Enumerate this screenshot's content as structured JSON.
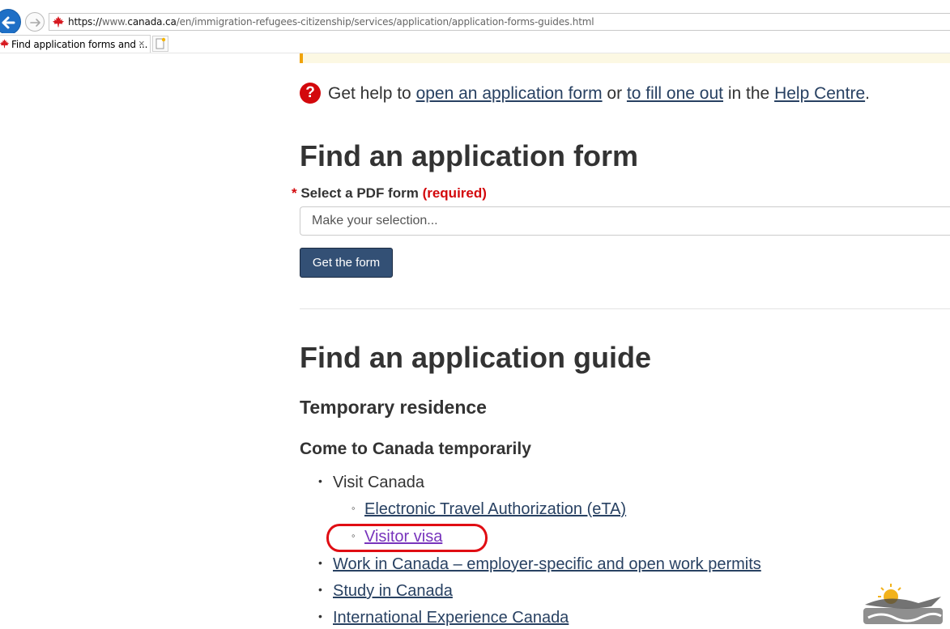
{
  "browser": {
    "url": {
      "protocol": "https://",
      "www": "www.",
      "host": "canada.ca",
      "path": "/en/immigration-refugees-citizenship/services/application/application-forms-guides.html"
    },
    "tab_title": "Find application forms and ...",
    "tab_close": "×"
  },
  "help": {
    "icon": "?",
    "prefix": "Get help to ",
    "link1": "open an application form",
    "mid1": " or ",
    "link2": "to fill one out",
    "mid2": " in the ",
    "link3": "Help Centre",
    "suffix": "."
  },
  "form_section": {
    "heading": "Find an application form",
    "label_star": "*",
    "label": " Select a PDF form ",
    "label_required": "(required)",
    "select_value": "Make your selection...",
    "button": "Get the form"
  },
  "guide_section": {
    "heading": "Find an application guide",
    "subheading": "Temporary residence",
    "group_heading": "Come to Canada temporarily",
    "items": [
      {
        "label": "Visit Canada"
      },
      {
        "label": "Electronic Travel Authorization (eTA)"
      },
      {
        "label": "Visitor visa"
      },
      {
        "label": "Work in Canada – employer-specific and open work permits"
      },
      {
        "label": "Study in Canada"
      },
      {
        "label": "International Experience Canada"
      }
    ]
  },
  "icons": {
    "back": "back-arrow-icon",
    "forward": "forward-arrow-icon",
    "site": "maple-leaf-icon",
    "help": "question-circle-icon",
    "new_tab": "new-tab-icon"
  },
  "colors": {
    "link": "#284162",
    "visited_link": "#7834bc",
    "button_bg": "#335075",
    "required": "#d3080c",
    "highlight_ring": "#e00d13",
    "browser_back": "#1e6fc6"
  }
}
